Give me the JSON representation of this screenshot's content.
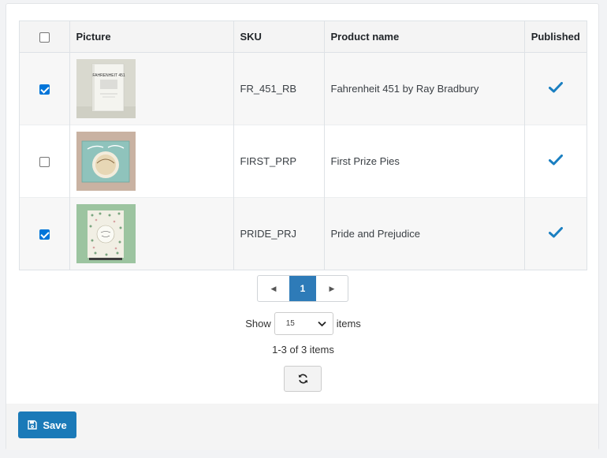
{
  "table": {
    "headers": {
      "picture": "Picture",
      "sku": "SKU",
      "product_name": "Product name",
      "published": "Published"
    },
    "select_all_checked": false,
    "rows": [
      {
        "checked": true,
        "picture_icon": "fahrenheit-451-book-image",
        "cover_text": "FAHRENHEIT 451",
        "sku": "FR_451_RB",
        "product_name": "Fahrenheit 451 by Ray Bradbury",
        "published": true
      },
      {
        "checked": false,
        "picture_icon": "first-prize-pies-book-image",
        "sku": "FIRST_PRP",
        "product_name": "First Prize Pies",
        "published": true
      },
      {
        "checked": true,
        "picture_icon": "pride-and-prejudice-book-image",
        "sku": "PRIDE_PRJ",
        "product_name": "Pride and Prejudice",
        "published": true
      }
    ]
  },
  "pager": {
    "prev_icon": "caret-left-icon",
    "current_page": "1",
    "next_icon": "caret-right-icon"
  },
  "page_size": {
    "show_label": "Show",
    "selected": "15",
    "items_label": "items"
  },
  "summary": "1-3 of 3 items",
  "refresh_icon": "refresh-icon",
  "footer": {
    "save_label": "Save",
    "save_icon": "floppy-disk-icon"
  },
  "colors": {
    "accent": "#1b7ab8",
    "check_blue": "#1a7fc1",
    "pager_active": "#2e7bb8"
  }
}
